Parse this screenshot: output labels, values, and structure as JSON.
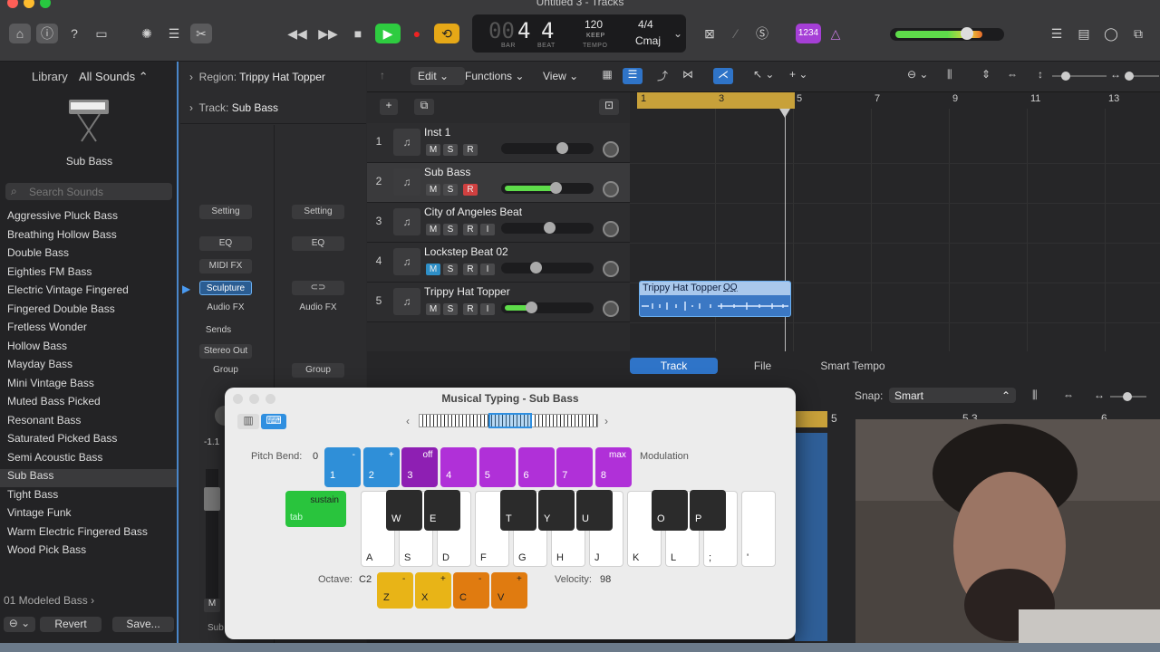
{
  "window": {
    "title": "Untitled 3 - Tracks"
  },
  "lcd": {
    "bar": "4",
    "beat": "4",
    "bar_label": "BAR",
    "beat_label": "BEAT",
    "tempo": "120",
    "tempo_mode": "KEEP",
    "tempo_label": "TEMPO",
    "signature": "4/4",
    "key": "Cmaj",
    "count_in": "1234"
  },
  "library": {
    "title": "Library",
    "filter": "All Sounds",
    "selected_patch": "Sub Bass",
    "search_placeholder": "Search Sounds",
    "items": [
      "Aggressive Pluck Bass",
      "Breathing Hollow Bass",
      "Double Bass",
      "Eighties FM Bass",
      "Electric Vintage Fingered",
      "Fingered Double Bass",
      "Fretless Wonder",
      "Hollow Bass",
      "Mayday Bass",
      "Mini Vintage Bass",
      "Muted Bass Picked",
      "Resonant Bass",
      "Saturated Picked Bass",
      "Semi Acoustic Bass",
      "Sub Bass",
      "Tight Bass",
      "Vintage Funk",
      "Warm Electric Fingered Bass",
      "Wood Pick Bass"
    ],
    "folder": "01 Modeled Bass",
    "revert": "Revert",
    "save": "Save..."
  },
  "inspector": {
    "region_label": "Region:",
    "region_name": "Trippy Hat Topper",
    "track_label": "Track:",
    "track_name": "Sub Bass",
    "left": {
      "setting": "Setting",
      "eq": "EQ",
      "midi_fx": "MIDI FX",
      "instrument": "Sculpture",
      "audio_fx": "Audio FX",
      "sends": "Sends",
      "output": "Stereo Out",
      "group": "Group",
      "fader_value": "-1.1",
      "m": "M",
      "name": "Sub"
    },
    "right": {
      "setting": "Setting",
      "eq": "EQ",
      "audio_fx": "Audio FX",
      "group": "Group"
    }
  },
  "menus": {
    "edit": "Edit",
    "functions": "Functions",
    "view": "View"
  },
  "tracks": [
    {
      "num": "1",
      "name": "Inst 1",
      "m": "M",
      "s": "S",
      "r": "R",
      "i": ""
    },
    {
      "num": "2",
      "name": "Sub Bass",
      "m": "M",
      "s": "S",
      "r": "R",
      "i": ""
    },
    {
      "num": "3",
      "name": "City of Angeles Beat",
      "m": "M",
      "s": "S",
      "r": "R",
      "i": "I"
    },
    {
      "num": "4",
      "name": "Lockstep Beat 02",
      "m": "M",
      "s": "S",
      "r": "R",
      "i": "I"
    },
    {
      "num": "5",
      "name": "Trippy Hat Topper",
      "m": "M",
      "s": "S",
      "r": "R",
      "i": "I"
    }
  ],
  "ruler": [
    "1",
    "3",
    "5",
    "7",
    "9",
    "11",
    "13"
  ],
  "region": {
    "name": "Trippy Hat Topper",
    "badge": "QQ"
  },
  "editor": {
    "tabs": [
      "Track",
      "File",
      "Smart Tempo"
    ],
    "snap_label": "Snap:",
    "snap_value": "Smart",
    "ruler": [
      "5",
      "5.3",
      "6"
    ]
  },
  "musical_typing": {
    "title": "Musical Typing - Sub Bass",
    "pitch_bend_label": "Pitch Bend:",
    "pitch_bend_value": "0",
    "modulation_label": "Modulation",
    "top_keys": [
      {
        "top": "-",
        "key": "1",
        "color": "#2f8fd8"
      },
      {
        "top": "+",
        "key": "2",
        "color": "#2f8fd8"
      },
      {
        "top": "off",
        "key": "3",
        "color": "#8e1fb3"
      },
      {
        "top": "",
        "key": "4",
        "color": "#b030d8"
      },
      {
        "top": "",
        "key": "5",
        "color": "#b030d8"
      },
      {
        "top": "",
        "key": "6",
        "color": "#b030d8"
      },
      {
        "top": "",
        "key": "7",
        "color": "#b030d8"
      },
      {
        "top": "max",
        "key": "8",
        "color": "#b030d8"
      }
    ],
    "sustain": "sustain",
    "tab": "tab",
    "black_keys": [
      "W",
      "E",
      "T",
      "Y",
      "U",
      "O",
      "P"
    ],
    "white_keys": [
      "A",
      "S",
      "D",
      "F",
      "G",
      "H",
      "J",
      "K",
      "L",
      ";",
      "'"
    ],
    "octave_label": "Octave:",
    "octave_value": "C2",
    "velocity_label": "Velocity:",
    "velocity_value": "98",
    "octave_keys": [
      {
        "top": "-",
        "key": "Z",
        "color": "#e8b417"
      },
      {
        "top": "+",
        "key": "X",
        "color": "#e8b417"
      },
      {
        "top": "-",
        "key": "C",
        "color": "#e07b10"
      },
      {
        "top": "+",
        "key": "V",
        "color": "#e07b10"
      }
    ]
  }
}
